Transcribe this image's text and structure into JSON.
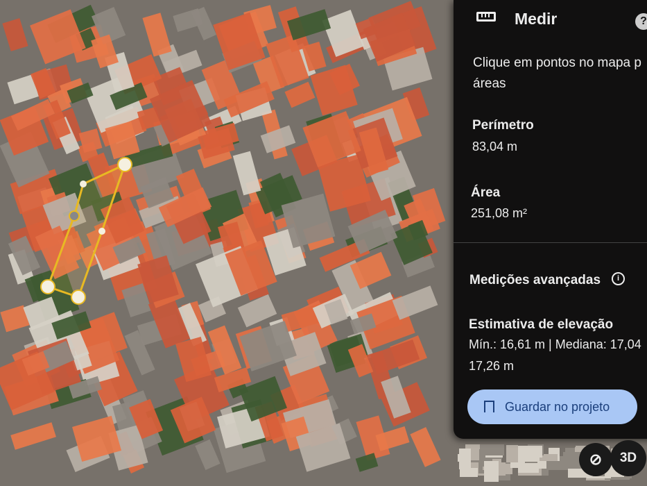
{
  "panel": {
    "title": "Medir",
    "help_icon": "?",
    "instructions": "Clique em pontos no mapa para medir distâncias e áreas",
    "instructions_visible_line1": "Clique em pontos no mapa p",
    "instructions_visible_line2": "áreas",
    "perimeter_label": "Perímetro",
    "perimeter_value": "83,04 m",
    "area_label": "Área",
    "area_value": "251,08 m²",
    "advanced_label": "Medições avançadas",
    "elevation_label": "Estimativa de elevação",
    "elevation_line1": "Mín.: 16,61 m | Mediana: 17,04",
    "elevation_line2": "17,26 m",
    "save_button": "Guardar no projeto"
  },
  "map_controls": {
    "threed_label": "3D"
  },
  "colors": {
    "panel_bg": "#111010",
    "button_bg": "#a9c7f5",
    "button_text": "#1b3f7c",
    "measure_line": "#e8b923",
    "roof": "#e0693f"
  }
}
